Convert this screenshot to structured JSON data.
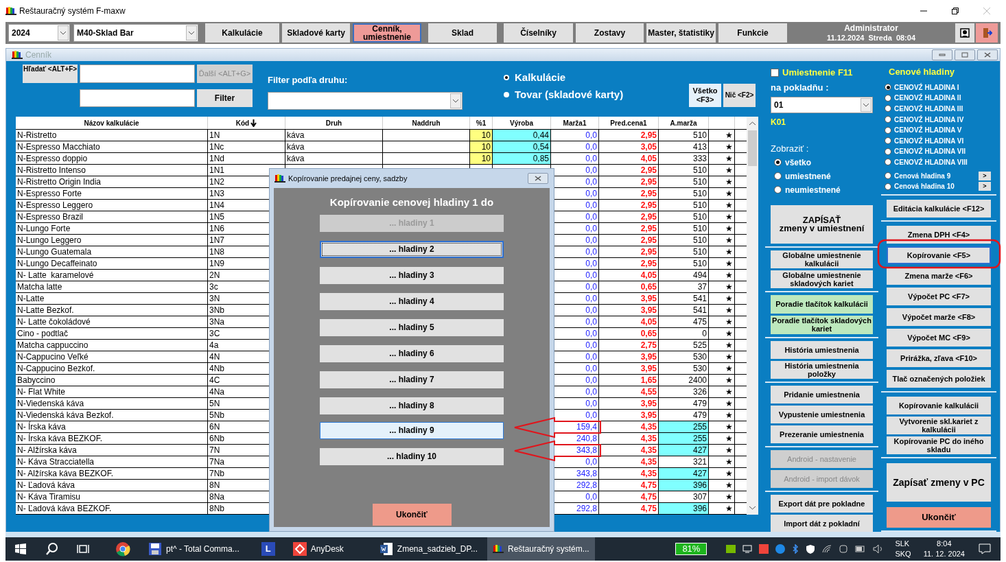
{
  "app_title": "Reštauračný systém F-maxw",
  "toolbar": {
    "year": "2024",
    "store": "M40-Sklad Bar",
    "user": "Administrator",
    "datetime": "11.12.2024  Streda  08:04",
    "buttons": [
      {
        "label": "Kalkulácie",
        "selected": false
      },
      {
        "label": "Skladové karty",
        "selected": false
      },
      {
        "label": "Cenník, umiestnenie",
        "selected": true
      },
      {
        "label": "Sklad",
        "selected": false
      },
      {
        "label": "Číselníky",
        "selected": false
      },
      {
        "label": "Zostavy",
        "selected": false
      },
      {
        "label": "Master, štatistiky",
        "selected": false
      },
      {
        "label": "Funkcie",
        "selected": false
      }
    ]
  },
  "cennik": {
    "title": "Cenník",
    "search_button": "Hľadať <ALT+F>",
    "next_button": "Ďalší <ALT+G>",
    "filter_button": "Filter",
    "filter_label": "Filter podľa druhu:",
    "modes": [
      {
        "label": "Kalkulácie",
        "selected": true
      },
      {
        "label": "Tovar (skladové karty)",
        "selected": false
      }
    ],
    "all_button": "Všetko <F3>",
    "none_button": "Nič <F2>"
  },
  "table": {
    "columns": [
      "Názov kalkulácie",
      "Kód",
      "Druh",
      "Naddruh",
      "%1",
      "Výroba",
      "Marža1",
      "Pred.cena1",
      "A.marža"
    ],
    "rows": [
      {
        "name": "N-Ristretto",
        "code": "1N",
        "druh": "káva",
        "pct": "10",
        "vyroba": "0,44",
        "marza": "0,0",
        "cena": "2,95",
        "amarza": "510",
        "highlight": false,
        "mark": "★"
      },
      {
        "name": "N-Espresso Macchiato",
        "code": "1Nc",
        "druh": "káva",
        "pct": "10",
        "vyroba": "0,54",
        "marza": "0,0",
        "cena": "3,05",
        "amarza": "413",
        "highlight": false,
        "mark": "★"
      },
      {
        "name": "N-Espresso doppio",
        "code": "1Nd",
        "druh": "káva",
        "pct": "10",
        "vyroba": "0,85",
        "marza": "0,0",
        "cena": "4,05",
        "amarza": "333",
        "highlight": false,
        "mark": "★"
      },
      {
        "name": "N-Ristretto Intenso",
        "code": "1N1",
        "marza": "0,0",
        "cena": "2,95",
        "amarza": "510",
        "highlight": false,
        "mark": "★"
      },
      {
        "name": "N-Ristretto Origin India",
        "code": "1N2",
        "marza": "0,0",
        "cena": "2,95",
        "amarza": "510",
        "highlight": false,
        "mark": "★"
      },
      {
        "name": "N-Espresso Forte",
        "code": "1N3",
        "marza": "0,0",
        "cena": "2,95",
        "amarza": "510",
        "highlight": false,
        "mark": "★"
      },
      {
        "name": "N-Espresso Leggero",
        "code": "1N4",
        "marza": "0,0",
        "cena": "2,95",
        "amarza": "510",
        "highlight": false,
        "mark": "★"
      },
      {
        "name": "N-Espresso Brazil",
        "code": "1N5",
        "marza": "0,0",
        "cena": "2,95",
        "amarza": "510",
        "highlight": false,
        "mark": "★"
      },
      {
        "name": "N-Lungo Forte",
        "code": "1N6",
        "marza": "0,0",
        "cena": "2,95",
        "amarza": "510",
        "highlight": false,
        "mark": "★"
      },
      {
        "name": "N-Lungo Leggero",
        "code": "1N7",
        "marza": "0,0",
        "cena": "2,95",
        "amarza": "510",
        "highlight": false,
        "mark": "★"
      },
      {
        "name": "N-Lungo Guatemala",
        "code": "1N8",
        "marza": "0,0",
        "cena": "2,95",
        "amarza": "510",
        "highlight": false,
        "mark": "★"
      },
      {
        "name": "N-Lungo Decaffeinato",
        "code": "1N9",
        "marza": "0,0",
        "cena": "2,95",
        "amarza": "510",
        "highlight": false,
        "mark": "★"
      },
      {
        "name": "N- Latte  karamelové",
        "code": "2N",
        "marza": "0,0",
        "cena": "4,05",
        "amarza": "494",
        "highlight": false,
        "mark": "★"
      },
      {
        "name": "Matcha latte",
        "code": "3c",
        "marza": "0,0",
        "cena": "0,65",
        "amarza": "37",
        "highlight": false,
        "mark": "★"
      },
      {
        "name": "N-Latte",
        "code": "3N",
        "marza": "0,0",
        "cena": "3,95",
        "amarza": "541",
        "highlight": false,
        "mark": "★"
      },
      {
        "name": "N-Latte Bezkof.",
        "code": "3Nb",
        "marza": "0,0",
        "cena": "3,95",
        "amarza": "541",
        "highlight": false,
        "mark": "★"
      },
      {
        "name": "N- Latte čokoládové",
        "code": "3Na",
        "marza": "0,0",
        "cena": "4,05",
        "amarza": "475",
        "highlight": false,
        "mark": "★"
      },
      {
        "name": "Cino - podtlač",
        "code": "3C",
        "marza": "0,0",
        "cena": "0,65",
        "amarza": "0",
        "highlight": false,
        "mark": "★"
      },
      {
        "name": "Matcha cappuccino",
        "code": "4a",
        "marza": "0,0",
        "cena": "2,75",
        "amarza": "525",
        "highlight": false,
        "mark": "★"
      },
      {
        "name": "N-Cappucino Veľké",
        "code": "4N",
        "marza": "0,0",
        "cena": "3,95",
        "amarza": "530",
        "highlight": false,
        "mark": "★"
      },
      {
        "name": "N-Cappucino Bezkof.",
        "code": "4Nb",
        "marza": "0,0",
        "cena": "3,95",
        "amarza": "530",
        "highlight": false,
        "mark": "★"
      },
      {
        "name": "Babyccino",
        "code": "4C",
        "marza": "0,0",
        "cena": "1,65",
        "amarza": "2400",
        "highlight": false,
        "mark": "★"
      },
      {
        "name": "N- Flat White",
        "code": "4Na",
        "marza": "0,0",
        "cena": "4,55",
        "amarza": "326",
        "highlight": false,
        "mark": "★"
      },
      {
        "name": "N-Viedenská káva",
        "code": "5N",
        "marza": "0,0",
        "cena": "3,95",
        "amarza": "479",
        "highlight": false,
        "mark": "★"
      },
      {
        "name": "N-Viedenská káva Bezkof.",
        "code": "5Nb",
        "marza": "0,0",
        "cena": "3,95",
        "amarza": "479",
        "highlight": false,
        "mark": "★"
      },
      {
        "name": "N- Írska káva",
        "code": "6N",
        "marza": "159,4",
        "cena": "4,35",
        "amarza": "255",
        "highlight": true,
        "mark": "★"
      },
      {
        "name": "N- Írska káva BEZKOF.",
        "code": "6Nb",
        "marza": "240,8",
        "cena": "4,35",
        "amarza": "255",
        "highlight": true,
        "mark": "★"
      },
      {
        "name": "N- Alžírska káva",
        "code": "7N",
        "marza": "343,8",
        "cena": "4,35",
        "amarza": "427",
        "highlight": true,
        "mark": "★"
      },
      {
        "name": "N- Káva Stracciatella",
        "code": "7Na",
        "marza": "0,0",
        "cena": "4,35",
        "amarza": "321",
        "highlight": false,
        "mark": "★"
      },
      {
        "name": "N- Alžírska káva BEZKOF.",
        "code": "7Nb",
        "marza": "343,8",
        "cena": "4,35",
        "amarza": "427",
        "highlight": true,
        "mark": "★"
      },
      {
        "name": "N- Ľadová káva",
        "code": "8N",
        "marza": "292,8",
        "cena": "4,75",
        "amarza": "396",
        "highlight": true,
        "mark": "★"
      },
      {
        "name": "N- Káva Tiramisu",
        "code": "8Na",
        "marza": "0,0",
        "cena": "4,75",
        "amarza": "307",
        "highlight": false,
        "mark": "★"
      },
      {
        "name": "N- Ľadová káva BEZKOF.",
        "code": "8Nb",
        "marza": "292,8",
        "cena": "4,75",
        "amarza": "396",
        "highlight": true,
        "mark": "★"
      }
    ]
  },
  "placement": {
    "checkbox": {
      "label": "Umiestnenie F11",
      "checked": false
    },
    "pos_label": "na pokladňu :",
    "pos_value": "01",
    "pos_code": "K01",
    "show_label": "Zobraziť :",
    "show_options": [
      {
        "label": "všetko",
        "selected": true
      },
      {
        "label": "umiestnené",
        "selected": false
      },
      {
        "label": "neumiestnené",
        "selected": false
      }
    ],
    "groups": [
      [
        {
          "label": "ZAPÍSAŤ\nzmeny v umiestnení",
          "kind": "large"
        }
      ],
      [
        {
          "label": "Globálne umiestnenie kalkulácii",
          "kind": "normal"
        },
        {
          "label": "Globálne umiestnenie skladových kariet",
          "kind": "normal"
        }
      ],
      [
        {
          "label": "Poradie tlačítok kalkulácii",
          "kind": "green"
        },
        {
          "label": "Poradie tlačítok skladových kariet",
          "kind": "green"
        }
      ],
      [
        {
          "label": "História umiestnenia",
          "kind": "normal"
        },
        {
          "label": "História umiestnenia položky",
          "kind": "normal"
        }
      ],
      [
        {
          "label": "Pridanie umiestnenia",
          "kind": "normal"
        },
        {
          "label": "Vypustenie umiestnenia",
          "kind": "normal"
        },
        {
          "label": "Prezeranie umiestnenia",
          "kind": "normal"
        }
      ],
      [
        {
          "label": "Android - nastavenie",
          "kind": "disabled"
        },
        {
          "label": "Android - import dávok",
          "kind": "disabled"
        }
      ],
      [
        {
          "label": "Export dát pre pokladne",
          "kind": "normal"
        },
        {
          "label": "Import dát z pokladní",
          "kind": "normal"
        }
      ]
    ]
  },
  "price_levels": {
    "title": "Cenové hladiny",
    "options": [
      {
        "label": "CENOVŹ HLADINA I",
        "selected": true
      },
      {
        "label": "CENOVŹ HLADINA II",
        "selected": false
      },
      {
        "label": "CENOVŹ HLADINA III",
        "selected": false
      },
      {
        "label": "CENOVŹ HLADINA IV",
        "selected": false
      },
      {
        "label": "CENOVŹ HLADINA V",
        "selected": false
      },
      {
        "label": "CENOVŹ HLADINA VI",
        "selected": false
      },
      {
        "label": "CENOVŹ HLADINA VII",
        "selected": false
      },
      {
        "label": "CENOVŹ HLADINA VIII",
        "selected": false
      },
      {
        "label": "Cenová hladina 9",
        "selected": false,
        "more": ">"
      },
      {
        "label": "Cenová hladina 10",
        "selected": false,
        "more": ">"
      }
    ]
  },
  "actions": [
    [
      {
        "label": "Editácia kalkulácie <F12>",
        "kind": "normal"
      }
    ],
    [
      {
        "label": "Zmena DPH <F4>",
        "kind": "normal"
      },
      {
        "label": "Kopírovanie <F5>",
        "kind": "focused"
      },
      {
        "label": "Zmena marže <F6>",
        "kind": "normal"
      },
      {
        "label": "Výpočet PC <F7>",
        "kind": "normal"
      },
      {
        "label": "Výpočet marže <F8>",
        "kind": "normal"
      },
      {
        "label": "Výpočet MC <F9>",
        "kind": "normal"
      },
      {
        "label": "Prirážka, zľava <F10>",
        "kind": "normal"
      },
      {
        "label": "Tlač označených položiek",
        "kind": "normal"
      }
    ],
    [
      {
        "label": "Kopírovanie kalkulácii",
        "kind": "normal"
      },
      {
        "label": "Vytvorenie  skl.kariet z kalkulácii",
        "kind": "normal"
      },
      {
        "label": "Kopírovanie PC do iného skladu",
        "kind": "normal"
      }
    ],
    [
      {
        "label": "Zapísať zmeny v PC",
        "kind": "large"
      },
      {
        "label": "Ukončiť",
        "kind": "danger"
      }
    ]
  ],
  "dialog": {
    "title": "Kopírovanie predajnej ceny, sadzby",
    "heading": "Kopírovanie cenovej hladiny 1 do",
    "buttons": [
      {
        "label": "... hladiny 1",
        "disabled": true,
        "focused": false,
        "hovered": false
      },
      {
        "label": "... hladiny 2",
        "disabled": false,
        "focused": true,
        "hovered": false
      },
      {
        "label": "... hladiny 3",
        "disabled": false,
        "focused": false,
        "hovered": false
      },
      {
        "label": "... hladiny 4",
        "disabled": false,
        "focused": false,
        "hovered": false
      },
      {
        "label": "... hladiny 5",
        "disabled": false,
        "focused": false,
        "hovered": false
      },
      {
        "label": "... hladiny 6",
        "disabled": false,
        "focused": false,
        "hovered": false
      },
      {
        "label": "... hladiny 7",
        "disabled": false,
        "focused": false,
        "hovered": false
      },
      {
        "label": "... hladiny 8",
        "disabled": false,
        "focused": false,
        "hovered": false
      },
      {
        "label": "... hladiny 9",
        "disabled": false,
        "focused": false,
        "hovered": true
      },
      {
        "label": "... hladiny 10",
        "disabled": false,
        "focused": false,
        "hovered": false
      }
    ],
    "close_button": "Ukončiť"
  },
  "taskbar": {
    "apps": [
      {
        "kind": "chrome",
        "active": false
      },
      {
        "kind": "disk",
        "label": "pt^ - Total Comma...",
        "active": false
      },
      {
        "kind": "letter",
        "letter": "L",
        "active": false
      },
      {
        "kind": "anydesk",
        "label": "AnyDesk",
        "active": false
      },
      {
        "kind": "word",
        "label": "Zmena_sadzieb_DP...",
        "active": false
      },
      {
        "kind": "app",
        "label": "Reštauračný systém...",
        "active": true
      }
    ],
    "battery": "81%",
    "lang": [
      "SLK",
      "SKQ"
    ],
    "time": "8:04",
    "date": "11. 12. 2024"
  }
}
